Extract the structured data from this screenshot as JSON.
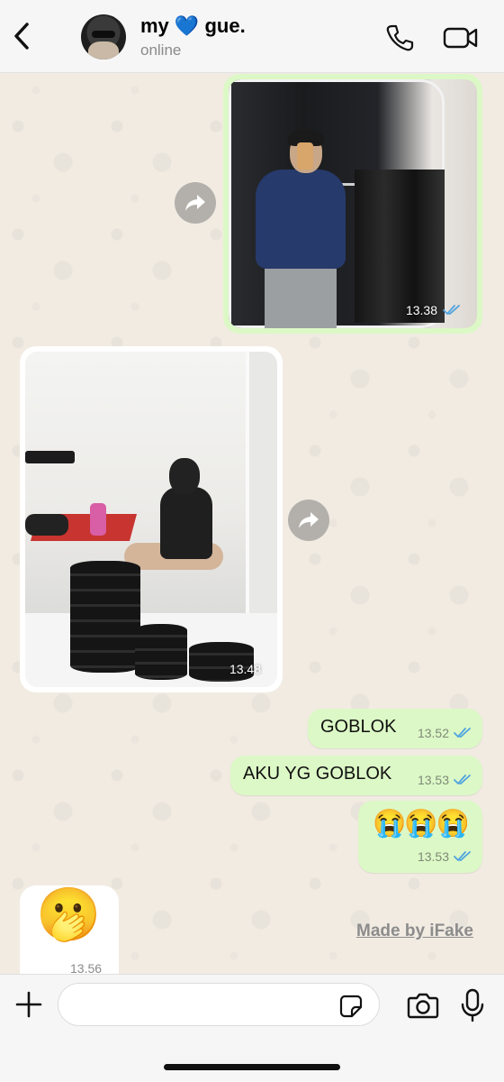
{
  "header": {
    "back_icon": "chevron-left-icon",
    "name_prefix": "my",
    "name_heart": "💙",
    "name_suffix": "gue.",
    "status": "online",
    "call_icon": "phone-icon",
    "video_icon": "video-camera-icon"
  },
  "messages": [
    {
      "type": "photo",
      "direction": "outgoing",
      "time": "13.38",
      "read": true
    },
    {
      "type": "photo",
      "direction": "incoming",
      "time": "13.48"
    },
    {
      "type": "text",
      "direction": "outgoing",
      "text": "GOBLOK",
      "time": "13.52",
      "read": true
    },
    {
      "type": "text",
      "direction": "outgoing",
      "text": "AKU YG GOBLOK",
      "time": "13.53",
      "read": true
    },
    {
      "type": "text",
      "direction": "outgoing",
      "text": "😭😭😭",
      "time": "13.53",
      "read": true
    },
    {
      "type": "emoji",
      "direction": "incoming",
      "text": "🫢",
      "time": "13.56"
    }
  ],
  "watermark": "Made by iFake",
  "input_bar": {
    "placeholder": "",
    "icons": [
      "plus-icon",
      "sticker-icon",
      "camera-icon",
      "microphone-icon"
    ]
  },
  "colors": {
    "outgoing_bubble": "#dcf8c6",
    "incoming_bubble": "#ffffff",
    "read_ticks": "#4fa3e0",
    "heart": "#69c3f2"
  }
}
